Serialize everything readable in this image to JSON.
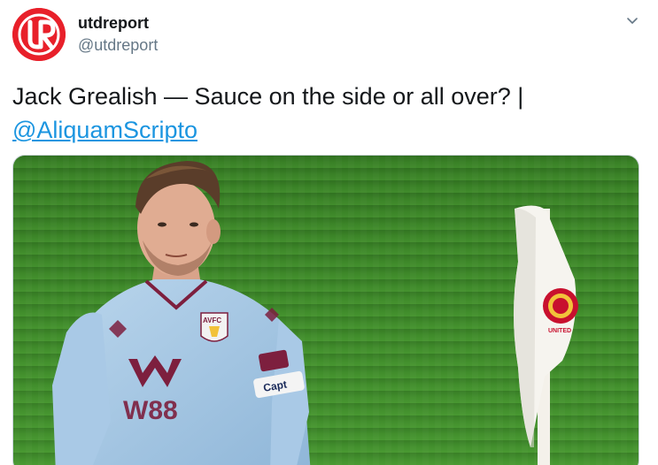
{
  "account": {
    "display_name": "utdreport",
    "handle": "@utdreport"
  },
  "tweet": {
    "text": "Jack Grealish — Sauce on the side or all over? |",
    "mention": "@AliquamScripto"
  },
  "photo": {
    "badge_text": "AVFC",
    "shirt_sponsor": "W88",
    "armband_text": "Capt",
    "flag_crest": "UNITED"
  },
  "colors": {
    "brand_red": "#e8202a",
    "link_blue": "#1b95e0",
    "handle_gray": "#657786",
    "pitch_green": "#3f8a2a"
  },
  "icons": {
    "caret": "chevron-down-icon",
    "avatar_logo": "ur-logo"
  }
}
